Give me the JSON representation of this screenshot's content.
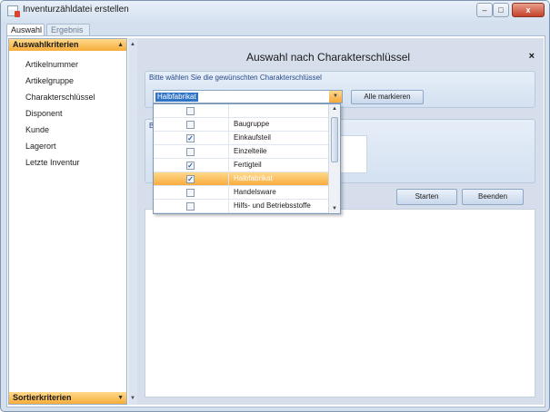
{
  "window": {
    "title": "Inventurzähldatei erstellen",
    "controls": {
      "minimize": "–",
      "maximize": "□",
      "close": "x"
    }
  },
  "tabs": [
    "Auswahl",
    "Ergebnis"
  ],
  "sidebar": {
    "header_top": "Auswahlkriterien",
    "header_bottom": "Sortierkriterien",
    "items": [
      "Artikelnummer",
      "Artikelgruppe",
      "Charakterschlüssel",
      "Disponent",
      "Kunde",
      "Lagerort",
      "Letzte Inventur"
    ]
  },
  "dialog": {
    "title": "Auswahl nach Charakterschlüssel",
    "close": "×",
    "group1_label": "Bitte wählen Sie die gewünschten Charakterschlüssel",
    "combo_value": "Halbfabrikat",
    "select_all_button": "Alle markieren",
    "group2_label": "B",
    "start_button": "Starten",
    "end_button": "Beenden"
  },
  "dropdown": {
    "items": [
      {
        "label": "",
        "checked": false,
        "selected": false
      },
      {
        "label": "Baugruppe",
        "checked": false,
        "selected": false
      },
      {
        "label": "Einkaufsteil",
        "checked": true,
        "selected": false
      },
      {
        "label": "Einzelteile",
        "checked": false,
        "selected": false
      },
      {
        "label": "Fertigteil",
        "checked": true,
        "selected": false
      },
      {
        "label": "Halbfabrikat",
        "checked": true,
        "selected": true
      },
      {
        "label": "Handelsware",
        "checked": false,
        "selected": false
      },
      {
        "label": "Hilfs- und Betriebsstoffe",
        "checked": false,
        "selected": false
      }
    ]
  },
  "colors": {
    "accent_orange": "#f6ad3b",
    "selection_blue": "#3074c8",
    "panel_blue": "#d5deea"
  },
  "icons": {
    "app": "document-icon",
    "checkmark": "✓",
    "dropdown_arrow": "▼",
    "scroll_up": "▲",
    "scroll_down": "▼"
  }
}
